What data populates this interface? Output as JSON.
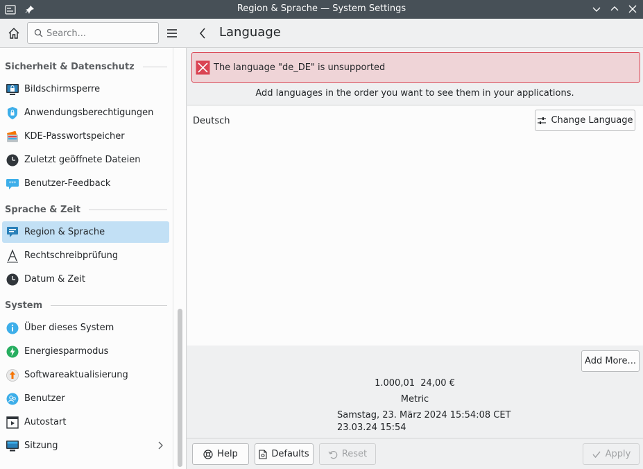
{
  "window": {
    "title": "Region & Sprache — System Settings"
  },
  "search": {
    "placeholder": "Search..."
  },
  "sidebar": {
    "sections": [
      {
        "label": "Sicherheit & Datenschutz",
        "items": [
          {
            "label": "Bildschirmsperre",
            "icon": "screen-lock-icon"
          },
          {
            "label": "Anwendungsberechtigungen",
            "icon": "shield-icon"
          },
          {
            "label": "KDE-Passwortspeicher",
            "icon": "wallet-icon"
          },
          {
            "label": "Zuletzt geöffnete Dateien",
            "icon": "clock-icon"
          },
          {
            "label": "Benutzer-Feedback",
            "icon": "feedback-icon"
          }
        ]
      },
      {
        "label": "Sprache & Zeit",
        "items": [
          {
            "label": "Region & Sprache",
            "icon": "region-icon",
            "selected": true
          },
          {
            "label": "Rechtschreibprüfung",
            "icon": "spellcheck-icon"
          },
          {
            "label": "Datum & Zeit",
            "icon": "clock-icon"
          }
        ]
      },
      {
        "label": "System",
        "items": [
          {
            "label": "Über dieses System",
            "icon": "info-icon"
          },
          {
            "label": "Energiesparmodus",
            "icon": "power-icon"
          },
          {
            "label": "Softwareaktualisierung",
            "icon": "update-icon"
          },
          {
            "label": "Benutzer",
            "icon": "users-icon"
          },
          {
            "label": "Autostart",
            "icon": "autostart-icon"
          },
          {
            "label": "Sitzung",
            "icon": "session-icon",
            "has_children": true
          }
        ]
      }
    ]
  },
  "main": {
    "title": "Language",
    "error": "The language \"de_DE\" is unsupported",
    "hint": "Add languages in the order you want to see them in your applications.",
    "languages": [
      "Deutsch"
    ],
    "change_language_label": "Change Language",
    "add_more_label": "Add More...",
    "numeric_example": "1.000,01",
    "currency_example": "24,00 €",
    "measurement": "Metric",
    "date_long": "Samstag, 23. März 2024 15:54:08 CET",
    "date_short": "23.03.24 15:54"
  },
  "footer": {
    "help_label": "Help",
    "defaults_label": "Defaults",
    "reset_label": "Reset",
    "apply_label": "Apply"
  },
  "colors": {
    "accent": "#3daee9",
    "selection": "#c2e0f5",
    "error_border": "#da4453",
    "error_bg": "#efd4d7",
    "titlebar": "#475057"
  }
}
